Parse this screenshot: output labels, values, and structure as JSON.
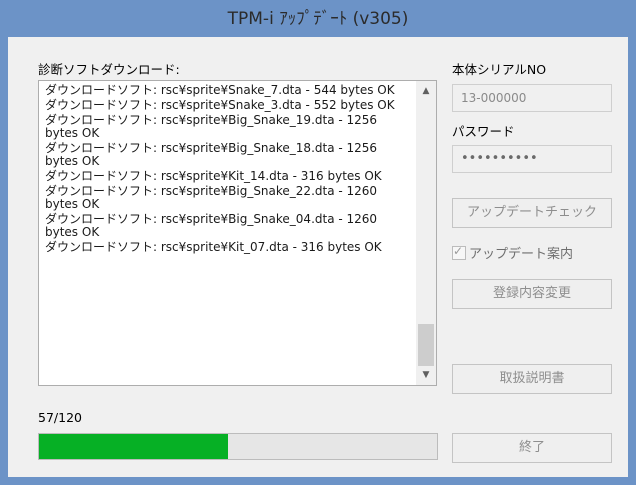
{
  "window": {
    "title": "TPM-i ｱｯﾌﾟﾃﾞｰﾄ (v305)"
  },
  "download": {
    "label": "診断ソフトダウンロード:",
    "log": [
      "ダウンロードソフト: rsc¥sprite¥Snake_7.dta - 544 bytes OK",
      "ダウンロードソフト: rsc¥sprite¥Snake_3.dta - 552 bytes OK",
      "ダウンロードソフト: rsc¥sprite¥Big_Snake_19.dta - 1256 bytes OK",
      "ダウンロードソフト: rsc¥sprite¥Big_Snake_18.dta - 1256 bytes OK",
      "ダウンロードソフト: rsc¥sprite¥Kit_14.dta - 316 bytes OK",
      "ダウンロードソフト: rsc¥sprite¥Big_Snake_22.dta - 1260 bytes OK",
      "ダウンロードソフト: rsc¥sprite¥Big_Snake_04.dta - 1260 bytes OK",
      "ダウンロードソフト: rsc¥sprite¥Kit_07.dta - 316 bytes OK"
    ],
    "scroll_up_icon": "chevron-up-icon",
    "scroll_down_icon": "chevron-down-icon"
  },
  "progress": {
    "text": "57/120",
    "fraction": 0.475,
    "color": "#06b025"
  },
  "serial": {
    "label": "本体シリアルNO",
    "value": "13-000000"
  },
  "password": {
    "label": "パスワード",
    "value": "••••••••••"
  },
  "buttons": {
    "update_check": "アップデートチェック",
    "registration_change": "登録内容変更",
    "manual": "取扱説明書",
    "exit": "終了"
  },
  "update_notice": {
    "label": "アップデート案内",
    "checked": true
  },
  "colors": {
    "title_bar": "#6c93c7",
    "progress_fill": "#06b025"
  }
}
